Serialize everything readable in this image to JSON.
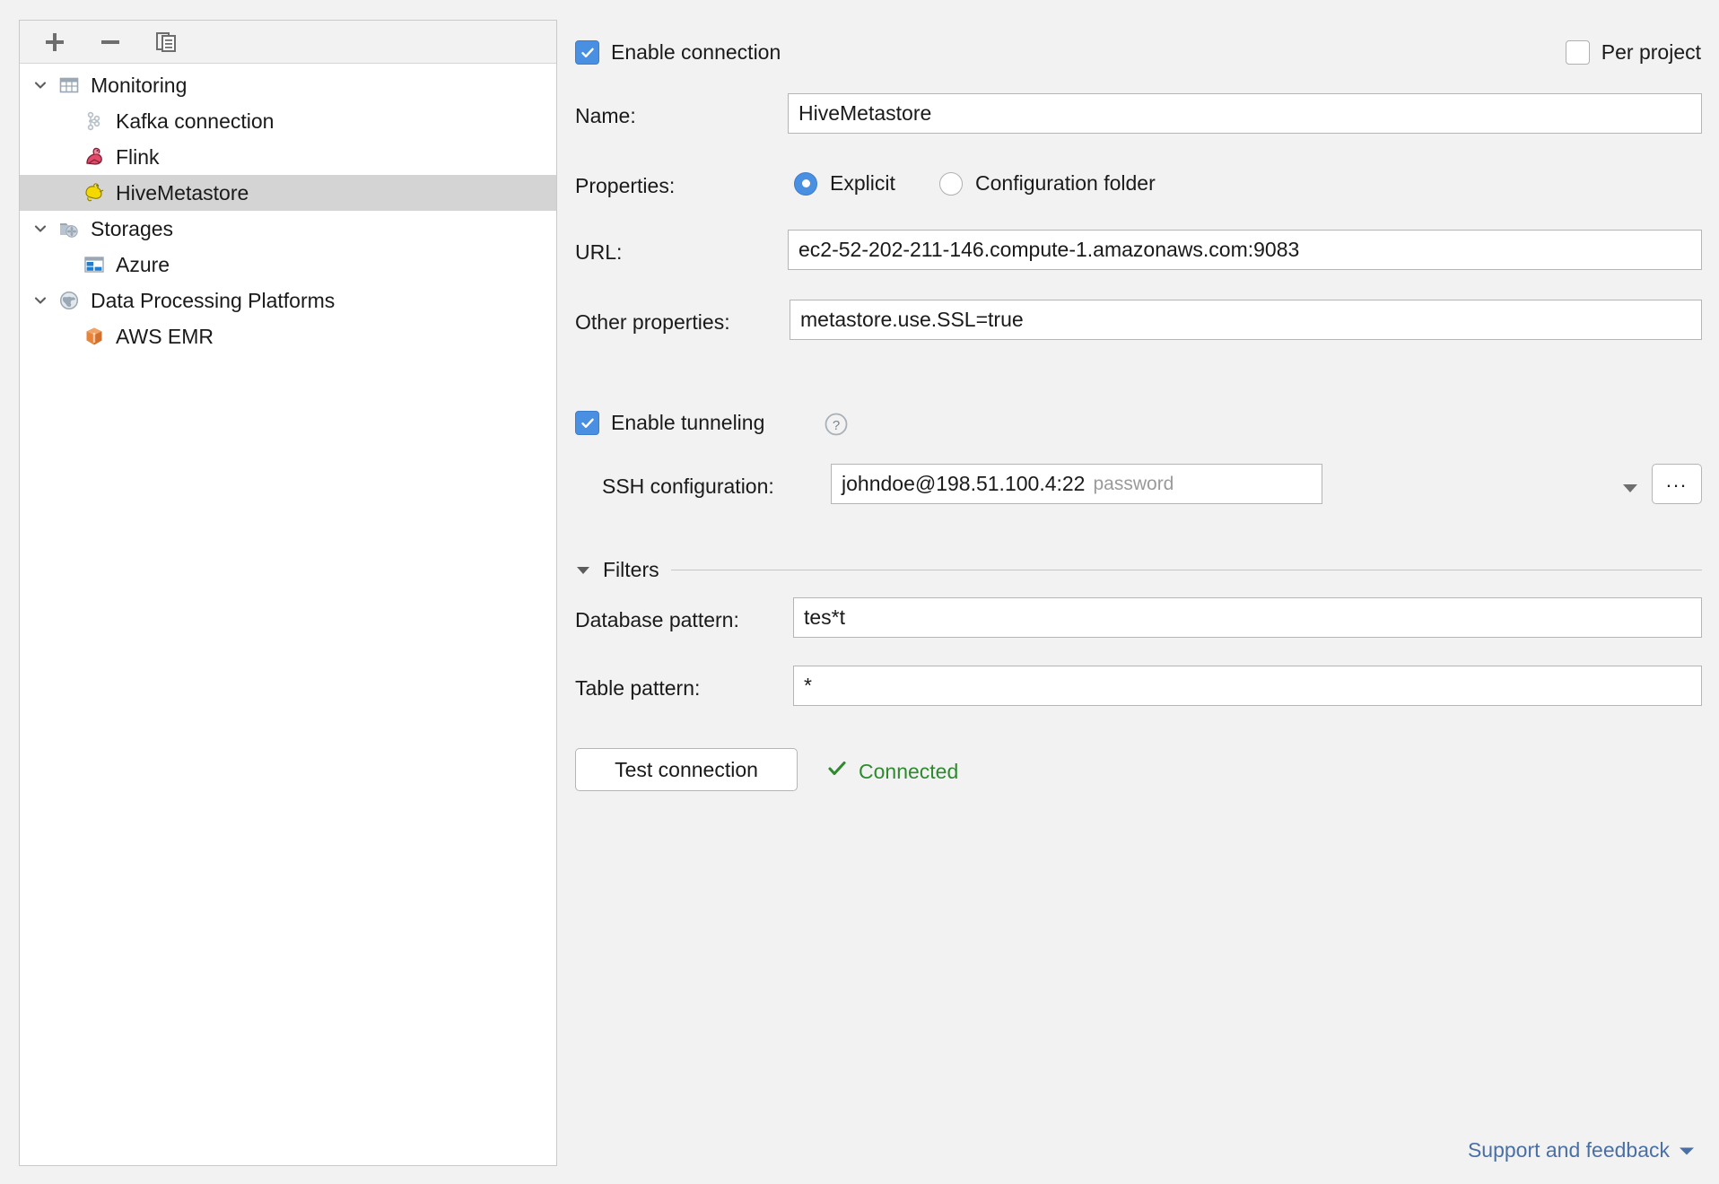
{
  "sidebar": {
    "toolbar": [
      {
        "name": "add-button",
        "icon": "plus-icon",
        "label": "Add"
      },
      {
        "name": "remove-button",
        "icon": "minus-icon",
        "label": "Remove"
      },
      {
        "name": "duplicate-button",
        "icon": "copy-icon",
        "label": "Duplicate"
      }
    ],
    "tree": [
      {
        "label": "Monitoring",
        "icon": "table-grid-icon",
        "level": 0,
        "expanded": true,
        "selected": false
      },
      {
        "label": "Kafka connection",
        "icon": "kafka-icon",
        "level": 1,
        "expanded": null,
        "selected": false
      },
      {
        "label": "Flink",
        "icon": "flink-icon",
        "level": 1,
        "expanded": null,
        "selected": false
      },
      {
        "label": "HiveMetastore",
        "icon": "hive-icon",
        "level": 1,
        "expanded": null,
        "selected": true
      },
      {
        "label": "Storages",
        "icon": "storages-folder-icon",
        "level": 0,
        "expanded": true,
        "selected": false
      },
      {
        "label": "Azure",
        "icon": "azure-icon",
        "level": 1,
        "expanded": null,
        "selected": false
      },
      {
        "label": "Data Processing Platforms",
        "icon": "globe-icon",
        "level": 0,
        "expanded": true,
        "selected": false
      },
      {
        "label": "AWS EMR",
        "icon": "aws-emr-icon",
        "level": 1,
        "expanded": null,
        "selected": false
      }
    ]
  },
  "panel": {
    "enable_connection": {
      "label": "Enable connection",
      "checked": true
    },
    "per_project": {
      "label": "Per project",
      "checked": false
    },
    "name": {
      "label": "Name:",
      "value": "HiveMetastore"
    },
    "properties": {
      "label": "Properties:",
      "options": [
        "Explicit",
        "Configuration folder"
      ],
      "selected": "Explicit"
    },
    "url": {
      "label": "URL:",
      "value": "ec2-52-202-211-146.compute-1.amazonaws.com:9083"
    },
    "other_properties": {
      "label": "Other properties:",
      "value": "metastore.use.SSL=true"
    },
    "enable_tunneling": {
      "label": "Enable tunneling",
      "checked": true,
      "help_icon": "help-question-icon"
    },
    "ssh_configuration": {
      "label": "SSH configuration:",
      "value": "johndoe@198.51.100.4:22",
      "auth_hint": "password",
      "browse_label": "...",
      "dropdown_icon": "chevron-down-icon"
    },
    "filters": {
      "title": "Filters",
      "expanded": true,
      "database_pattern": {
        "label": "Database pattern:",
        "value": "tes*t"
      },
      "table_pattern": {
        "label": "Table pattern:",
        "value": "*"
      }
    },
    "test_connection": {
      "label": "Test connection"
    },
    "status": {
      "text": "Connected",
      "icon": "check-icon",
      "color": "#2f8a2f"
    },
    "support": {
      "label": "Support and feedback",
      "icon": "chevron-down-icon",
      "color": "#4a6fa5"
    }
  },
  "colors": {
    "accent": "#4a90e2",
    "background": "#f2f2f2",
    "panel_background": "#ffffff",
    "selection": "#d4d4d4",
    "link": "#4a6fa5",
    "success": "#2f8a2f"
  }
}
